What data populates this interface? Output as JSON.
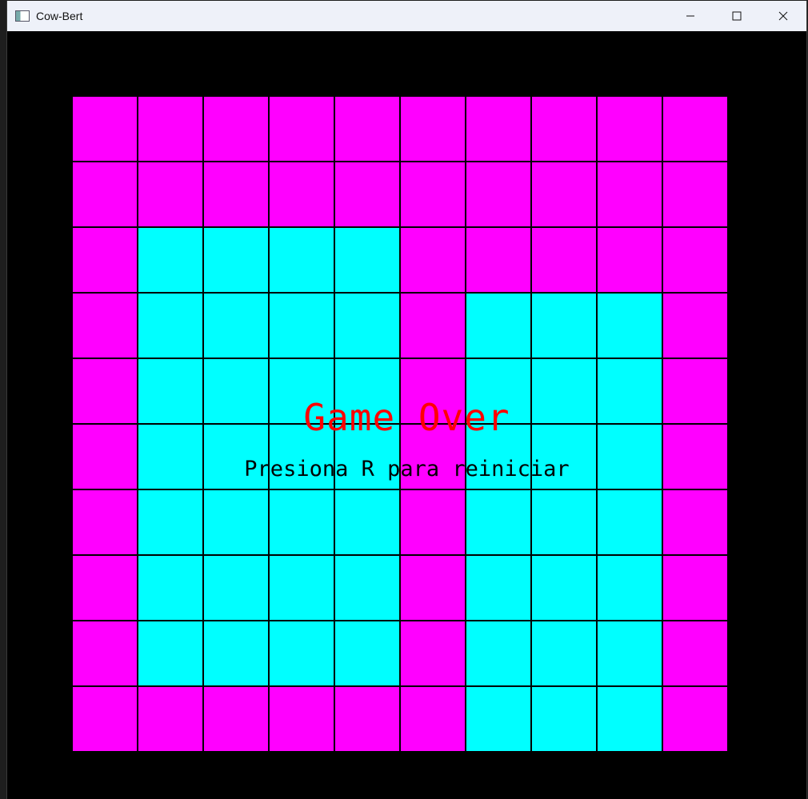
{
  "window": {
    "title": "Cow-Bert",
    "icon": "app-window-icon",
    "controls": [
      "minimize-icon",
      "maximize-icon",
      "close-icon"
    ]
  },
  "colors": {
    "magenta": "#ff00ff",
    "cyan": "#00ffff",
    "gridline": "#000000",
    "background": "#000000",
    "game_over": "#ff0000",
    "subtitle": "#000000"
  },
  "board": {
    "rows": 10,
    "cols": 10,
    "legend": {
      "M": "magenta",
      "C": "cyan"
    },
    "tiles": [
      "MMMMMMMMMM",
      "MMMMMMMMMM",
      "MCCCCMMMMM",
      "MCCCCMCCCM",
      "MCCCCMCCCM",
      "MCCCCMCCCM",
      "MCCCCMCCCM",
      "MCCCCMCCCM",
      "MCCCCMCCCM",
      "MMMMMMCCCM"
    ]
  },
  "overlay": {
    "title": "Game Over",
    "subtitle": "Presiona R para reiniciar"
  }
}
